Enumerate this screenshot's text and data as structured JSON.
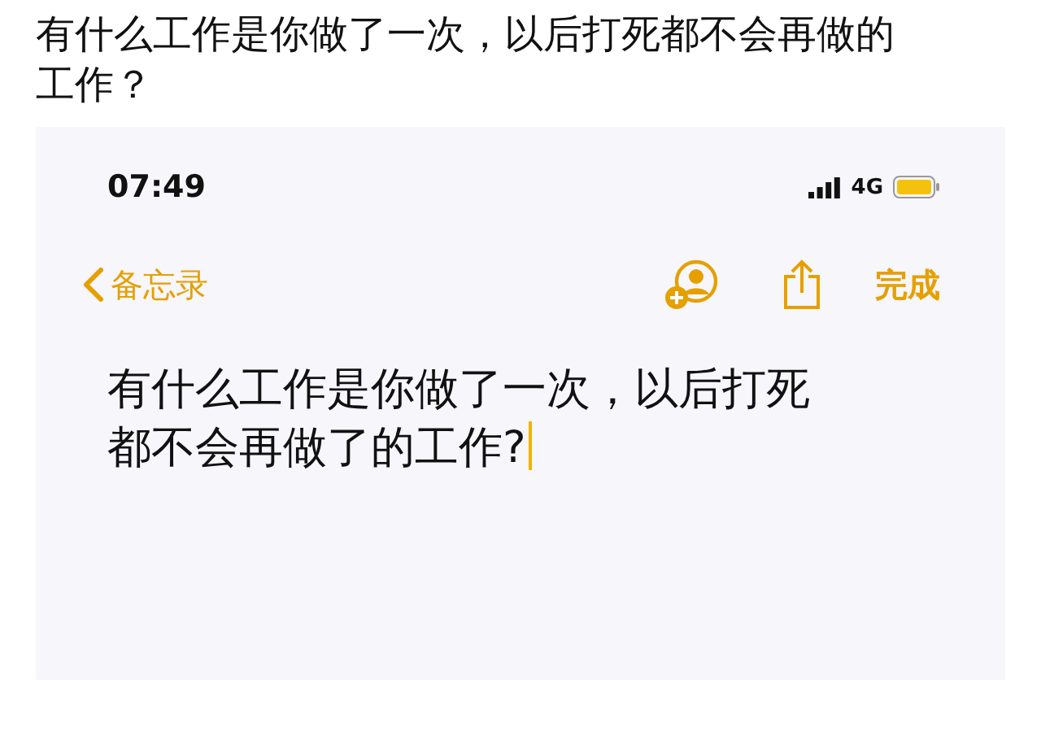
{
  "question": "有什么工作是你做了一次，以后打死都不会再做的工作？",
  "phone": {
    "status_bar": {
      "time": "07:49",
      "network": "4G"
    },
    "nav": {
      "back_label": "备忘录",
      "done_label": "完成"
    },
    "note": {
      "text": "有什么工作是你做了一次，以后打死都不会再做了的工作?",
      "cursor": true
    }
  }
}
